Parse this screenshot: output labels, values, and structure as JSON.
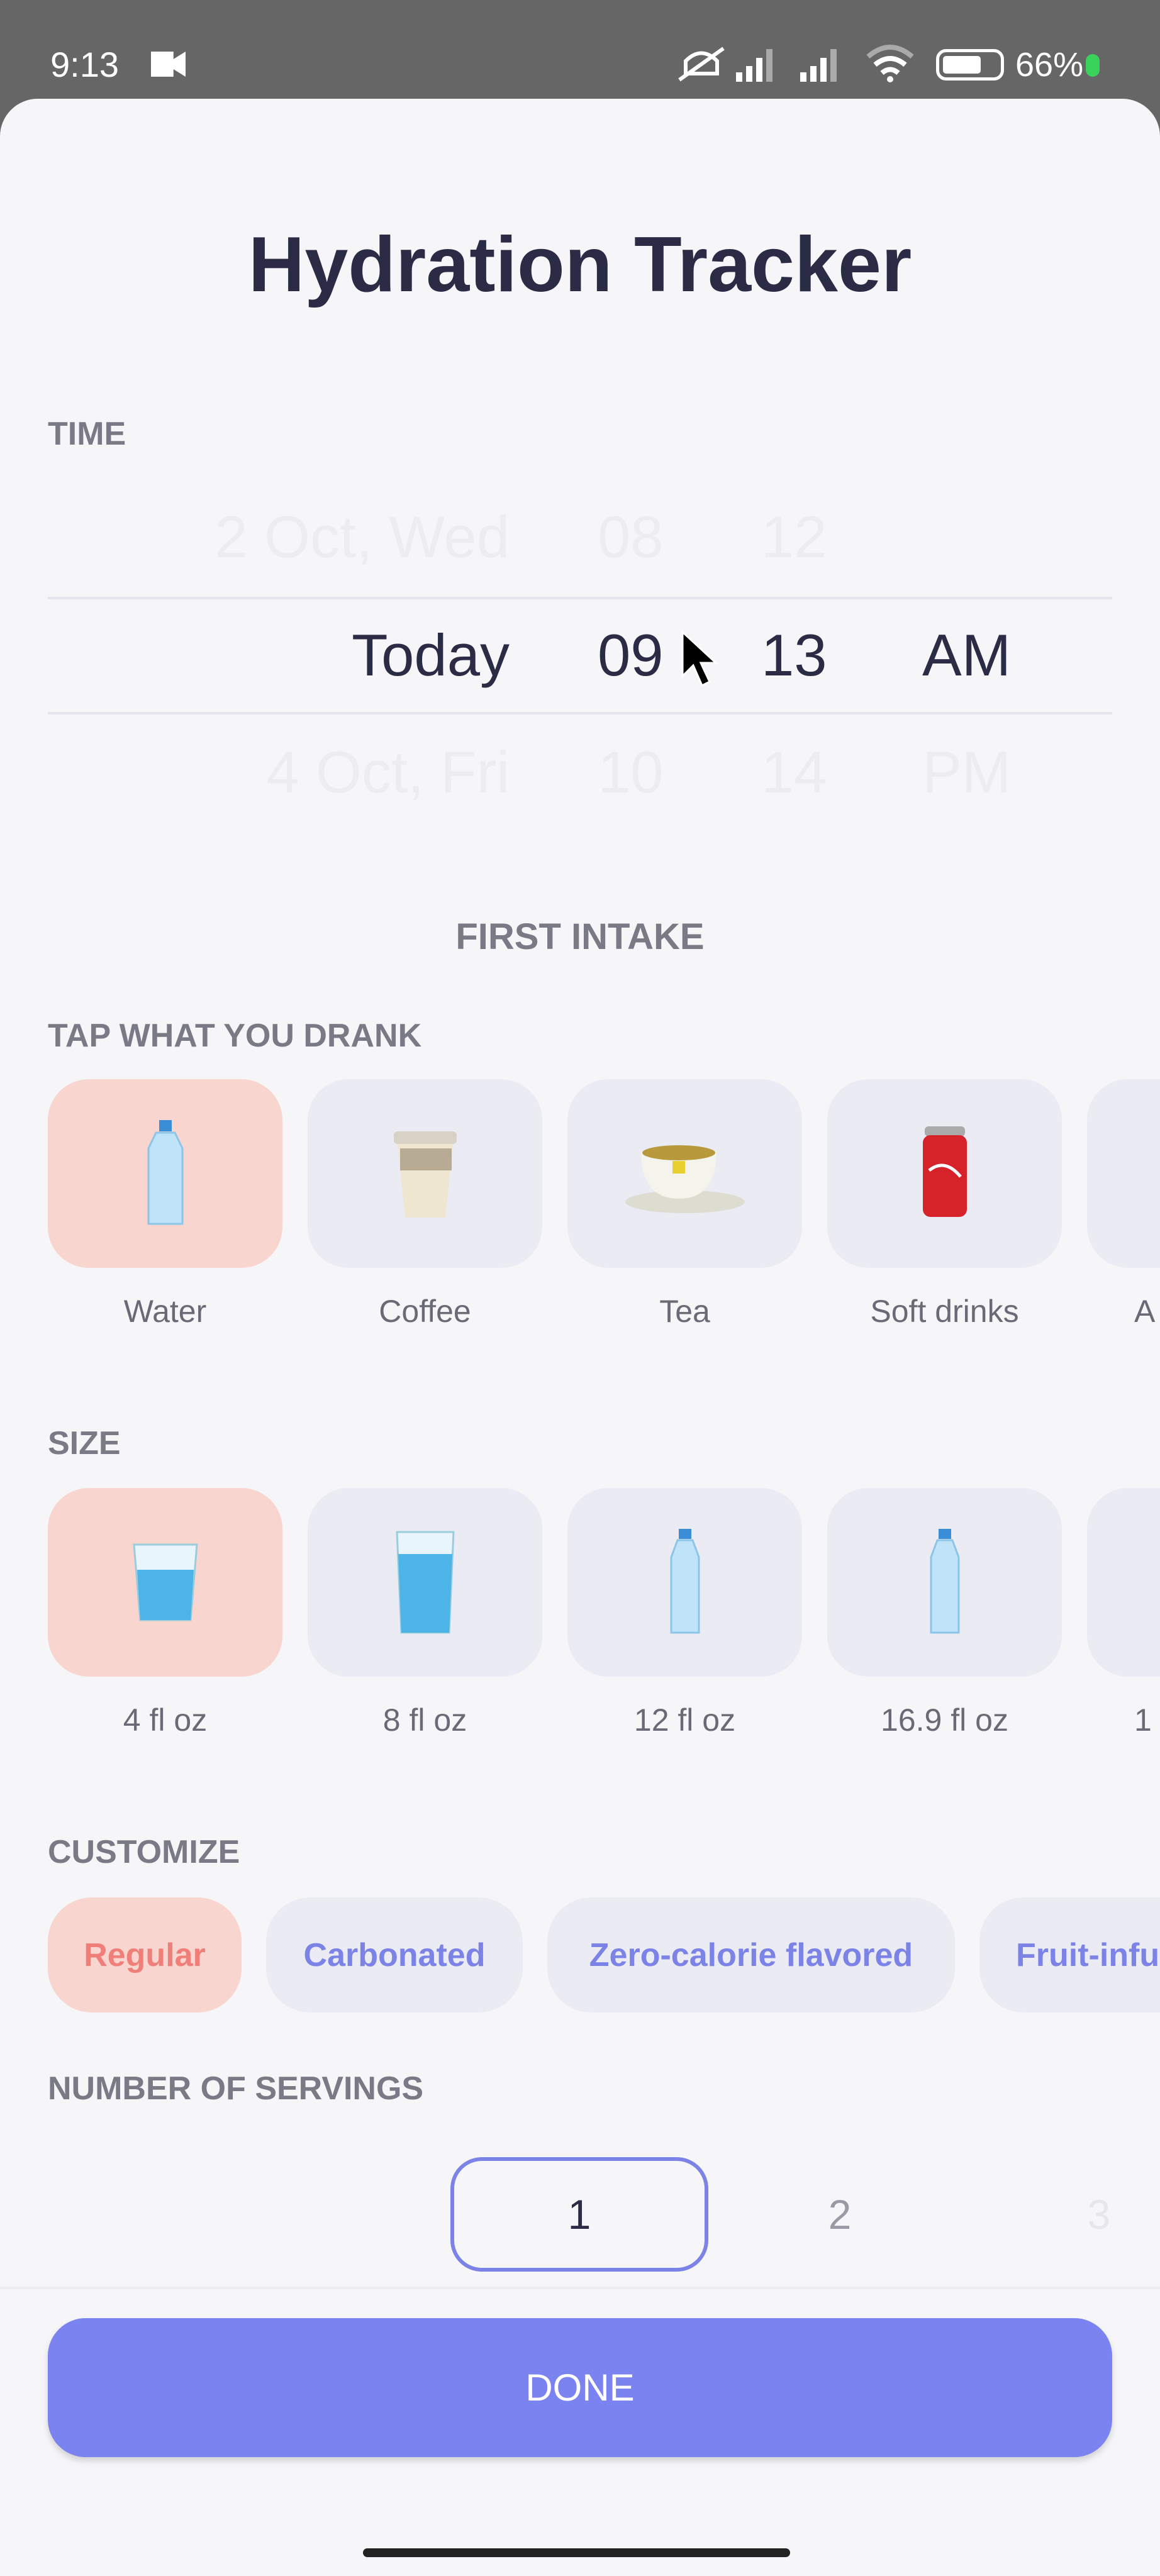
{
  "status_bar": {
    "time": "9:13",
    "battery": "66%",
    "icons": [
      "video-camera-icon",
      "mute-icon",
      "signal-icon",
      "signal-icon",
      "wifi-icon",
      "battery-icon"
    ]
  },
  "title": "Hydration Tracker",
  "time_section": {
    "label": "TIME",
    "date": {
      "prev": "2 Oct, Wed",
      "selected": "Today",
      "next": "4 Oct, Fri"
    },
    "hour": {
      "prev": "08",
      "selected": "09",
      "next": "10"
    },
    "minute": {
      "prev": "12",
      "selected": "13",
      "next": "14"
    },
    "period": {
      "selected": "AM",
      "next": "PM"
    }
  },
  "intake_heading": "FIRST INTAKE",
  "drink_section": {
    "label": "TAP WHAT YOU DRANK",
    "items": [
      {
        "label": "Water",
        "icon": "water-bottle-icon",
        "selected": true
      },
      {
        "label": "Coffee",
        "icon": "coffee-cup-icon",
        "selected": false
      },
      {
        "label": "Tea",
        "icon": "tea-cup-icon",
        "selected": false
      },
      {
        "label": "Soft drinks",
        "icon": "soda-can-icon",
        "selected": false
      },
      {
        "label": "A",
        "icon": "",
        "selected": false
      }
    ]
  },
  "size_section": {
    "label": "SIZE",
    "items": [
      {
        "label": "4 fl oz",
        "icon": "small-glass-icon",
        "selected": true
      },
      {
        "label": "8 fl oz",
        "icon": "tall-glass-icon",
        "selected": false
      },
      {
        "label": "12 fl oz",
        "icon": "bottle-icon",
        "selected": false
      },
      {
        "label": "16.9 fl oz",
        "icon": "bottle-icon",
        "selected": false
      },
      {
        "label": "1",
        "icon": "",
        "selected": false
      }
    ]
  },
  "customize_section": {
    "label": "CUSTOMIZE",
    "chips": [
      {
        "label": "Regular",
        "selected": true
      },
      {
        "label": "Carbonated",
        "selected": false
      },
      {
        "label": "Zero-calorie flavored",
        "selected": false
      },
      {
        "label": "Fruit-infu",
        "selected": false
      }
    ]
  },
  "servings_section": {
    "label": "NUMBER OF SERVINGS",
    "selected": "1",
    "next": "2",
    "next2": "3"
  },
  "done_label": "DONE",
  "colors": {
    "accent": "#7b83f0",
    "selected_bg": "#f8d5cf",
    "selected_text": "#ef7f78"
  }
}
